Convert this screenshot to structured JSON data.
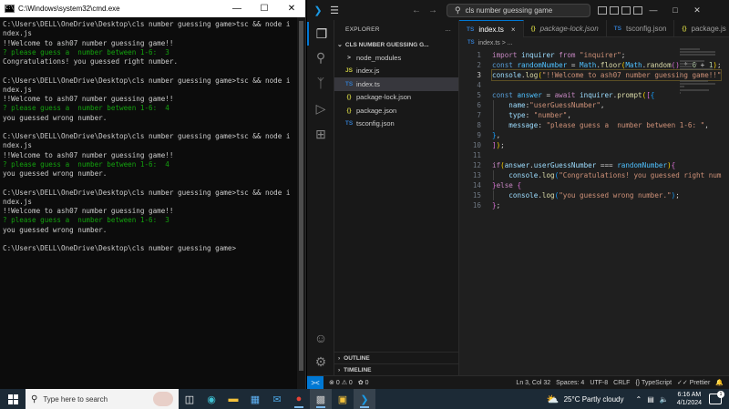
{
  "cmd": {
    "title": "C:\\Windows\\system32\\cmd.exe",
    "lines": [
      {
        "text": "C:\\Users\\DELL\\OneDrive\\Desktop\\cls number guessing game>tsc && node i",
        "green": false
      },
      {
        "text": "ndex.js",
        "green": false
      },
      {
        "text": "!!Welcome to ash07 number guessing game!!",
        "green": false
      },
      {
        "text": "? please guess a  number between 1-6:  3",
        "green": true
      },
      {
        "text": "Congratulations! you guessed right number.",
        "green": false
      },
      {
        "text": "",
        "green": false
      },
      {
        "text": "C:\\Users\\DELL\\OneDrive\\Desktop\\cls number guessing game>tsc && node i",
        "green": false
      },
      {
        "text": "ndex.js",
        "green": false
      },
      {
        "text": "!!Welcome to ash07 number guessing game!!",
        "green": false
      },
      {
        "text": "? please guess a  number between 1-6:  4",
        "green": true
      },
      {
        "text": "you guessed wrong number.",
        "green": false
      },
      {
        "text": "",
        "green": false
      },
      {
        "text": "C:\\Users\\DELL\\OneDrive\\Desktop\\cls number guessing game>tsc && node i",
        "green": false
      },
      {
        "text": "ndex.js",
        "green": false
      },
      {
        "text": "!!Welcome to ash07 number guessing game!!",
        "green": false
      },
      {
        "text": "? please guess a  number between 1-6:  4",
        "green": true
      },
      {
        "text": "you guessed wrong number.",
        "green": false
      },
      {
        "text": "",
        "green": false
      },
      {
        "text": "C:\\Users\\DELL\\OneDrive\\Desktop\\cls number guessing game>tsc && node i",
        "green": false
      },
      {
        "text": "ndex.js",
        "green": false
      },
      {
        "text": "!!Welcome to ash07 number guessing game!!",
        "green": false
      },
      {
        "text": "? please guess a  number between 1-6:  3",
        "green": true
      },
      {
        "text": "you guessed wrong number.",
        "green": false
      },
      {
        "text": "",
        "green": false
      },
      {
        "text": "C:\\Users\\DELL\\OneDrive\\Desktop\\cls number guessing game>",
        "green": false
      }
    ]
  },
  "vscode": {
    "search_text": "cls number guessing game",
    "explorer_title": "EXPLORER",
    "explorer_more": "...",
    "project_name": "CLS NUMBER GUESSING G...",
    "tree": [
      {
        "name": "node_modules",
        "icon": "chevron-right",
        "glyph": ">",
        "cls": "ic-folder",
        "selected": false
      },
      {
        "name": "index.js",
        "icon": "js",
        "glyph": "JS",
        "cls": "ic-js",
        "selected": false
      },
      {
        "name": "index.ts",
        "icon": "ts",
        "glyph": "TS",
        "cls": "ic-ts",
        "selected": true
      },
      {
        "name": "package-lock.json",
        "icon": "json",
        "glyph": "{}",
        "cls": "ic-json",
        "selected": false
      },
      {
        "name": "package.json",
        "icon": "json",
        "glyph": "{}",
        "cls": "ic-json",
        "selected": false
      },
      {
        "name": "tsconfig.json",
        "icon": "tsconfig",
        "glyph": "TS",
        "cls": "ic-ts",
        "selected": false
      }
    ],
    "outline_label": "OUTLINE",
    "timeline_label": "TIMELINE",
    "tabs": [
      {
        "label": "index.ts",
        "glyph": "TS",
        "cls": "ic-ts",
        "active": true,
        "italic": false
      },
      {
        "label": "package-lock.json",
        "glyph": "{}",
        "cls": "ic-json",
        "active": false,
        "italic": true
      },
      {
        "label": "tsconfig.json",
        "glyph": "TS",
        "cls": "ic-ts",
        "active": false,
        "italic": false
      },
      {
        "label": "package.js",
        "glyph": "{}",
        "cls": "ic-json",
        "active": false,
        "italic": false
      }
    ],
    "tab_close": "×",
    "breadcrumb": "index.ts > ...",
    "code": [
      [
        [
          "k",
          "import "
        ],
        [
          "v",
          "inquirer "
        ],
        [
          "k",
          "from "
        ],
        [
          "s",
          "\"inquirer\""
        ],
        [
          "p",
          ";"
        ]
      ],
      [
        [
          "kb",
          "const "
        ],
        [
          "c",
          "randomNumber "
        ],
        [
          "p",
          "= "
        ],
        [
          "c",
          "Math"
        ],
        [
          "p",
          "."
        ],
        [
          "f",
          "floor"
        ],
        [
          "y",
          "("
        ],
        [
          "c",
          "Math"
        ],
        [
          "p",
          "."
        ],
        [
          "f",
          "random"
        ],
        [
          "m",
          "()"
        ],
        [
          "p",
          " * "
        ],
        [
          "n",
          "6"
        ],
        [
          "p",
          " + "
        ],
        [
          "n",
          "1"
        ],
        [
          "y",
          ")"
        ],
        [
          "p",
          ";"
        ]
      ],
      [
        [
          "v",
          "console"
        ],
        [
          "p",
          "."
        ],
        [
          "f",
          "log"
        ],
        [
          "y",
          "("
        ],
        [
          "s",
          "\"!!Welcome to ash07 number guessing game!!\""
        ]
      ],
      [],
      [
        [
          "kb",
          "const "
        ],
        [
          "c",
          "answer "
        ],
        [
          "p",
          "= "
        ],
        [
          "k",
          "await "
        ],
        [
          "v",
          "inquirer"
        ],
        [
          "p",
          "."
        ],
        [
          "f",
          "prompt"
        ],
        [
          "y",
          "("
        ],
        [
          "m",
          "["
        ],
        [
          "b",
          "{"
        ]
      ],
      [
        [
          "p",
          "    "
        ],
        [
          "v",
          "name"
        ],
        [
          "p",
          ":"
        ],
        [
          "s",
          "\"userGuessNumber\""
        ],
        [
          "p",
          ","
        ]
      ],
      [
        [
          "p",
          "    "
        ],
        [
          "v",
          "type"
        ],
        [
          "p",
          ": "
        ],
        [
          "s",
          "\"number\""
        ],
        [
          "p",
          ","
        ]
      ],
      [
        [
          "p",
          "    "
        ],
        [
          "v",
          "message"
        ],
        [
          "p",
          ": "
        ],
        [
          "s",
          "\"please guess a  number between 1-6: \""
        ],
        [
          "p",
          ","
        ]
      ],
      [
        [
          "b",
          "}"
        ],
        [
          "p",
          ","
        ]
      ],
      [
        [
          "m",
          "]"
        ],
        [
          "y",
          ")"
        ],
        [
          "p",
          ";"
        ]
      ],
      [],
      [
        [
          "k",
          "if"
        ],
        [
          "y",
          "("
        ],
        [
          "v",
          "answer"
        ],
        [
          "p",
          "."
        ],
        [
          "v",
          "userGuessNumber"
        ],
        [
          "p",
          " === "
        ],
        [
          "c",
          "randomNumber"
        ],
        [
          "y",
          ")"
        ],
        [
          "m",
          "{"
        ]
      ],
      [
        [
          "p",
          "    "
        ],
        [
          "v",
          "console"
        ],
        [
          "p",
          "."
        ],
        [
          "f",
          "log"
        ],
        [
          "b",
          "("
        ],
        [
          "s",
          "\"Congratulations! you guessed right num"
        ]
      ],
      [
        [
          "m",
          "}"
        ],
        [
          "k",
          "else "
        ],
        [
          "m",
          "{"
        ]
      ],
      [
        [
          "p",
          "    "
        ],
        [
          "v",
          "console"
        ],
        [
          "p",
          "."
        ],
        [
          "f",
          "log"
        ],
        [
          "b",
          "("
        ],
        [
          "s",
          "\"you guessed wrong number.\""
        ],
        [
          "b",
          ")"
        ],
        [
          "p",
          ";"
        ]
      ],
      [
        [
          "m",
          "}"
        ],
        [
          "p",
          ";"
        ]
      ]
    ],
    "current_line": 3,
    "status": {
      "remote": "><",
      "errors": "0",
      "warnings": "0",
      "ports": "0",
      "position": "Ln 3, Col 32",
      "spaces": "Spaces: 4",
      "encoding": "UTF-8",
      "eol": "CRLF",
      "language": "TypeScript",
      "prettier": "Prettier"
    }
  },
  "taskbar": {
    "search_placeholder": "Type here to search",
    "weather": "25°C  Partly cloudy",
    "time": "6:16 AM",
    "date": "4/1/2024",
    "notification_count": "1"
  },
  "colors": {
    "cmd_green": "#13a10e",
    "vscode_accent": "#0078d4",
    "taskbar_bg": "#1c2a36"
  }
}
